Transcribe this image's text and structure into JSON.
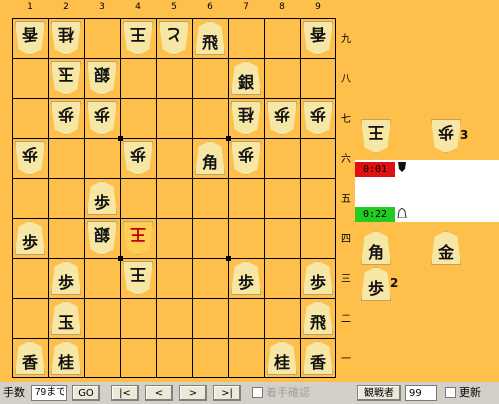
{
  "board": {
    "column_numbers": [
      "1",
      "2",
      "3",
      "4",
      "5",
      "6",
      "7",
      "8",
      "9"
    ],
    "row_numbers": [
      "九",
      "八",
      "七",
      "六",
      "五",
      "四",
      "三",
      "二",
      "一"
    ],
    "pieces": [
      {
        "col": 1,
        "row": 1,
        "ch": "香",
        "owner": "gote"
      },
      {
        "col": 2,
        "row": 1,
        "ch": "桂",
        "owner": "gote"
      },
      {
        "col": 4,
        "row": 1,
        "ch": "王",
        "owner": "gote"
      },
      {
        "col": 5,
        "row": 1,
        "ch": "と",
        "owner": "gote",
        "promoted": true
      },
      {
        "col": 6,
        "row": 1,
        "ch": "飛",
        "owner": "sente"
      },
      {
        "col": 9,
        "row": 1,
        "ch": "香",
        "owner": "gote"
      },
      {
        "col": 2,
        "row": 2,
        "ch": "玉",
        "owner": "gote"
      },
      {
        "col": 3,
        "row": 2,
        "ch": "銀",
        "owner": "gote"
      },
      {
        "col": 7,
        "row": 2,
        "ch": "銀",
        "owner": "sente"
      },
      {
        "col": 2,
        "row": 3,
        "ch": "歩",
        "owner": "gote"
      },
      {
        "col": 3,
        "row": 3,
        "ch": "歩",
        "owner": "gote"
      },
      {
        "col": 7,
        "row": 3,
        "ch": "桂",
        "owner": "gote"
      },
      {
        "col": 8,
        "row": 3,
        "ch": "歩",
        "owner": "gote"
      },
      {
        "col": 9,
        "row": 3,
        "ch": "歩",
        "owner": "gote"
      },
      {
        "col": 1,
        "row": 4,
        "ch": "歩",
        "owner": "gote"
      },
      {
        "col": 4,
        "row": 4,
        "ch": "歩",
        "owner": "gote"
      },
      {
        "col": 6,
        "row": 4,
        "ch": "角",
        "owner": "sente"
      },
      {
        "col": 7,
        "row": 4,
        "ch": "歩",
        "owner": "gote"
      },
      {
        "col": 3,
        "row": 5,
        "ch": "歩",
        "owner": "sente"
      },
      {
        "col": 1,
        "row": 6,
        "ch": "歩",
        "owner": "sente"
      },
      {
        "col": 3,
        "row": 6,
        "ch": "銀",
        "owner": "gote"
      },
      {
        "col": 4,
        "row": 6,
        "ch": "王",
        "owner": "gote",
        "red": true,
        "last": true
      },
      {
        "col": 2,
        "row": 7,
        "ch": "歩",
        "owner": "sente"
      },
      {
        "col": 4,
        "row": 7,
        "ch": "王",
        "owner": "gote"
      },
      {
        "col": 7,
        "row": 7,
        "ch": "歩",
        "owner": "sente"
      },
      {
        "col": 9,
        "row": 7,
        "ch": "歩",
        "owner": "sente"
      },
      {
        "col": 2,
        "row": 8,
        "ch": "玉",
        "owner": "sente"
      },
      {
        "col": 9,
        "row": 8,
        "ch": "飛",
        "owner": "sente"
      },
      {
        "col": 1,
        "row": 9,
        "ch": "香",
        "owner": "sente"
      },
      {
        "col": 2,
        "row": 9,
        "ch": "桂",
        "owner": "sente"
      },
      {
        "col": 8,
        "row": 9,
        "ch": "桂",
        "owner": "sente"
      },
      {
        "col": 9,
        "row": 9,
        "ch": "香",
        "owner": "sente"
      }
    ]
  },
  "gote_hand": [
    {
      "ch": "王",
      "count": ""
    },
    {
      "ch": "歩",
      "count": "3"
    }
  ],
  "sente_hand": [
    {
      "ch": "角",
      "count": ""
    },
    {
      "ch": "金",
      "count": ""
    },
    {
      "ch": "歩",
      "count": "2"
    }
  ],
  "clocks": {
    "gote_time": "0:01",
    "sente_time": "0:22",
    "gote_color": "#e01010",
    "sente_color": "#22cc22"
  },
  "controls": {
    "move_count_label": "手数",
    "move_count_value": "79まで",
    "go_label": "GO",
    "first_label": "|<",
    "prev_label": "<",
    "next_label": ">",
    "last_label": ">|",
    "confirm_move_label": "着手確認",
    "spectators_label": "観戦者",
    "spectators_count": "99",
    "refresh_label": "更新"
  }
}
